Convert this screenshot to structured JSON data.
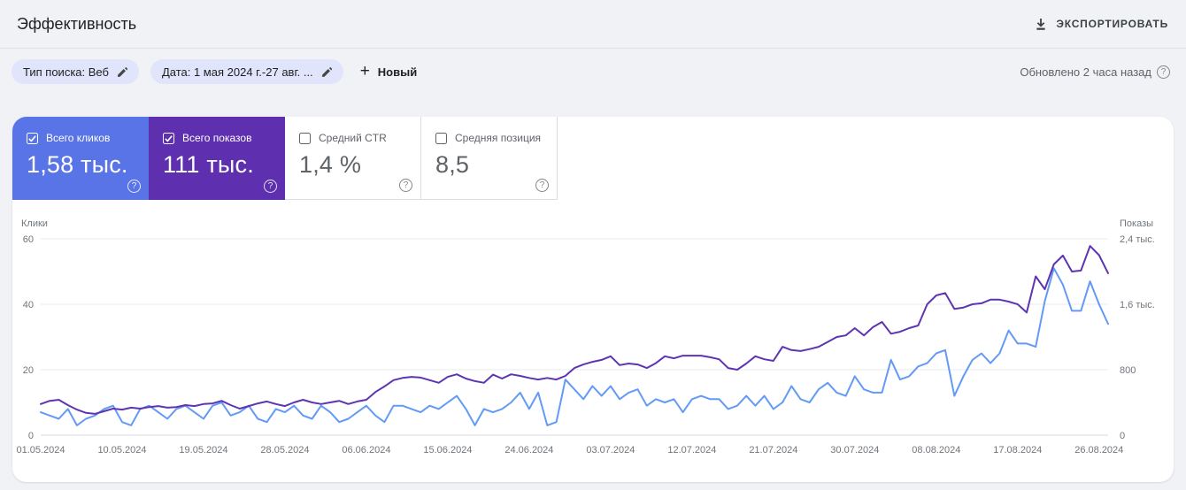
{
  "header": {
    "title": "Эффективность",
    "export_label": "ЭКСПОРТИРОВАТЬ"
  },
  "filters": {
    "chips": [
      {
        "label": "Тип поиска: Веб"
      },
      {
        "label": "Дата: 1 мая 2024 г.-27 авг. ..."
      }
    ],
    "new_label": "Новый",
    "updated_text": "Обновлено 2 часа назад"
  },
  "metrics": [
    {
      "label": "Всего кликов",
      "value": "1,58 тыс.",
      "checked": true,
      "bg": "#5974e6"
    },
    {
      "label": "Всего показов",
      "value": "111 тыс.",
      "checked": true,
      "bg": "#5e30af"
    },
    {
      "label": "Средний CTR",
      "value": "1,4 %",
      "checked": false,
      "bg": ""
    },
    {
      "label": "Средняя позиция",
      "value": "8,5",
      "checked": false,
      "bg": ""
    }
  ],
  "chart_data": {
    "type": "line",
    "title": "Эффективность: клики и показы по дням, 01.05.2024–27.08.2024",
    "grid": true,
    "grid_color": "#e9ebee",
    "axis_line_color": "#d6d9dc",
    "left_axis": {
      "label": "Клики",
      "max": 60,
      "ticks": [
        {
          "label": "60",
          "v": 60
        },
        {
          "label": "40",
          "v": 40
        },
        {
          "label": "20",
          "v": 20
        },
        {
          "label": "0",
          "v": 0
        }
      ]
    },
    "right_axis": {
      "label": "Показы",
      "max": 2400,
      "ticks": [
        {
          "label": "2,4 тыс.",
          "v": 2400
        },
        {
          "label": "1,6 тыс.",
          "v": 1600
        },
        {
          "label": "800",
          "v": 800
        },
        {
          "label": "0",
          "v": 0
        }
      ]
    },
    "x_ticks": [
      {
        "label": "01.05.2024",
        "day": 0
      },
      {
        "label": "10.05.2024",
        "day": 9
      },
      {
        "label": "19.05.2024",
        "day": 18
      },
      {
        "label": "28.05.2024",
        "day": 27
      },
      {
        "label": "06.06.2024",
        "day": 36
      },
      {
        "label": "15.06.2024",
        "day": 45
      },
      {
        "label": "24.06.2024",
        "day": 54
      },
      {
        "label": "03.07.2024",
        "day": 63
      },
      {
        "label": "12.07.2024",
        "day": 72
      },
      {
        "label": "21.07.2024",
        "day": 81
      },
      {
        "label": "30.07.2024",
        "day": 90
      },
      {
        "label": "08.08.2024",
        "day": 99
      },
      {
        "label": "17.08.2024",
        "day": 108
      },
      {
        "label": "26.08.2024",
        "day": 117
      }
    ],
    "series": [
      {
        "name": "Клики",
        "axis": "left",
        "color": "#639af5",
        "values": [
          7,
          6,
          5,
          8,
          3,
          5,
          6,
          8,
          9,
          4,
          3,
          8,
          9,
          7,
          5,
          8,
          9,
          7,
          5,
          9,
          10,
          6,
          7,
          9,
          5,
          4,
          8,
          7,
          9,
          6,
          5,
          9,
          7,
          4,
          5,
          7,
          9,
          6,
          4,
          9,
          9,
          8,
          7,
          9,
          8,
          10,
          12,
          8,
          3,
          8,
          7,
          8,
          10,
          13,
          8,
          13,
          3,
          4,
          17,
          14,
          11,
          15,
          12,
          15,
          11,
          13,
          14,
          9,
          11,
          10,
          11,
          7,
          11,
          12,
          11,
          11,
          8,
          9,
          12,
          9,
          12,
          8,
          10,
          15,
          11,
          10,
          14,
          16,
          13,
          12,
          18,
          14,
          13,
          13,
          23,
          17,
          18,
          21,
          22,
          25,
          26,
          12,
          18,
          23,
          25,
          22,
          25,
          32,
          28,
          28,
          27,
          41,
          51,
          46,
          38,
          38,
          47,
          40,
          34
        ]
      },
      {
        "name": "Показы",
        "axis": "right",
        "color": "#5e35b1",
        "values": [
          380,
          420,
          432,
          368,
          312,
          272,
          260,
          292,
          324,
          312,
          336,
          324,
          344,
          356,
          336,
          344,
          368,
          356,
          380,
          388,
          420,
          368,
          324,
          356,
          388,
          412,
          380,
          356,
          400,
          432,
          400,
          380,
          400,
          420,
          380,
          412,
          432,
          528,
          596,
          672,
          700,
          712,
          704,
          672,
          640,
          712,
          744,
          692,
          660,
          640,
          740,
          692,
          744,
          724,
          700,
          680,
          700,
          680,
          724,
          820,
          864,
          896,
          920,
          964,
          856,
          876,
          864,
          820,
          880,
          964,
          940,
          972,
          972,
          972,
          952,
          928,
          820,
          800,
          876,
          964,
          928,
          908,
          1080,
          1040,
          1028,
          1052,
          1080,
          1140,
          1200,
          1220,
          1308,
          1220,
          1320,
          1384,
          1240,
          1264,
          1308,
          1340,
          1600,
          1708,
          1736,
          1544,
          1560,
          1600,
          1612,
          1656,
          1656,
          1632,
          1600,
          1500,
          1940,
          1784,
          2088,
          2196,
          2000,
          2012,
          2312,
          2200,
          1980
        ]
      }
    ]
  }
}
